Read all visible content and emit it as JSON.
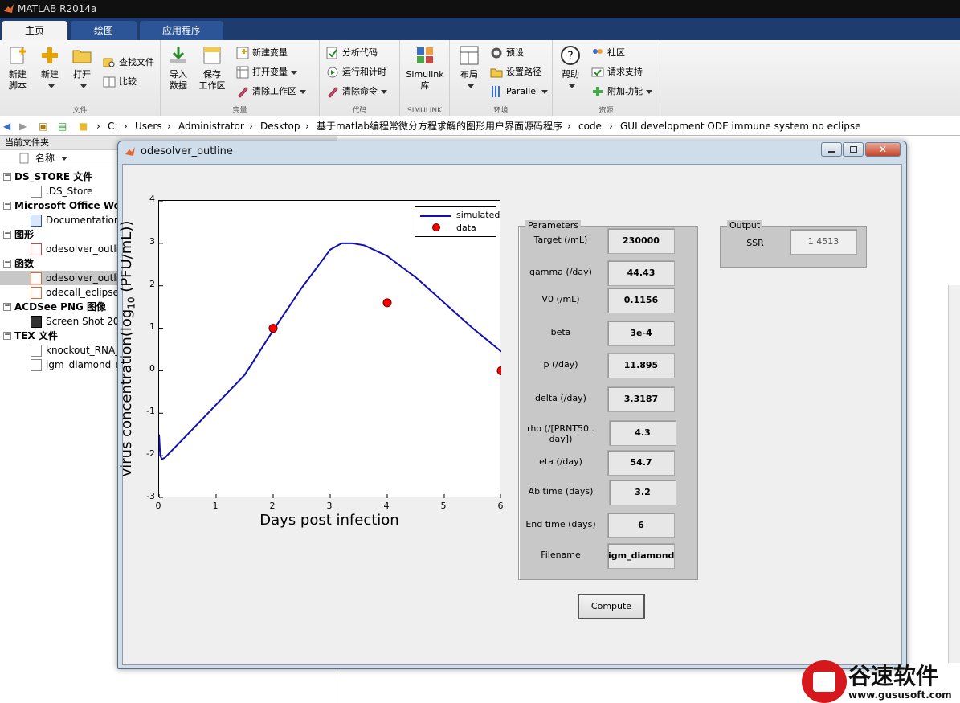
{
  "window": {
    "title": "MATLAB R2014a"
  },
  "tabs": [
    {
      "label": "主页"
    },
    {
      "label": "绘图"
    },
    {
      "label": "应用程序"
    }
  ],
  "ribbon": {
    "file": {
      "group_label": "文件",
      "new_script": "新建\n脚本",
      "new": "新建",
      "open": "打开",
      "find_files": "查找文件",
      "compare": "比较"
    },
    "variable": {
      "group_label": "变量",
      "import": "导入\n数据",
      "save_workspace": "保存\n工作区",
      "new_variable": "新建变量",
      "open_variable": "打开变量",
      "clear_workspace": "清除工作区"
    },
    "code": {
      "group_label": "代码",
      "analyze": "分析代码",
      "run_time": "运行和计时",
      "clear_commands": "清除命令"
    },
    "simulink": {
      "group_label": "SIMULINK",
      "library": "Simulink\n库"
    },
    "environment": {
      "group_label": "环境",
      "layout": "布局",
      "preferences": "预设",
      "set_path": "设置路径",
      "parallel": "Parallel"
    },
    "resources": {
      "group_label": "资源",
      "help": "帮助",
      "community": "社区",
      "request_support": "请求支持",
      "addons": "附加功能"
    }
  },
  "address": {
    "crumbs": [
      "C:",
      "Users",
      "Administrator",
      "Desktop",
      "基于matlab编程常微分方程求解的图形用户界面源码程序",
      "code",
      "GUI development ODE immune system no eclipse"
    ]
  },
  "left_pane": {
    "title": "当前文件夹",
    "column": "名称",
    "rows": [
      {
        "label": "DS_STORE 文件"
      },
      {
        "label": ".DS_Store"
      },
      {
        "label": "Microsoft Office Wo"
      },
      {
        "label": "Documentation"
      },
      {
        "label": "图形"
      },
      {
        "label": "odesolver_outli"
      },
      {
        "label": "函数"
      },
      {
        "label": "odesolver_outli"
      },
      {
        "label": "odecall_eclipse"
      },
      {
        "label": "ACDSee PNG 图像"
      },
      {
        "label": "Screen Shot 20"
      },
      {
        "label": "TEX 文件"
      },
      {
        "label": "knockout_RNA_"
      },
      {
        "label": "igm_diamond_r"
      }
    ]
  },
  "figure": {
    "title": "odesolver_outline",
    "xlabel": "Days post infection",
    "ylabel": "virus concentration(log",
    "ylabel_sub": "10",
    "ylabel_tail": " (PFU/mL))",
    "legend": {
      "line": "simulated",
      "marker": "data"
    },
    "parameters_title": "Parameters",
    "parameters": [
      {
        "label": "Target (/mL)",
        "value": "230000"
      },
      {
        "label": "gamma (/day)",
        "value": "44.43"
      },
      {
        "label": "V0 (/mL)",
        "value": "0.1156"
      },
      {
        "label": "beta",
        "value": "3e-4"
      },
      {
        "label": "p (/day)",
        "value": "11.895"
      },
      {
        "label": "delta (/day)",
        "value": "3.3187"
      },
      {
        "label": "rho (/[PRNT50 .\nday])",
        "value": "4.3"
      },
      {
        "label": "eta (/day)",
        "value": "54.7"
      },
      {
        "label": "Ab time (days)",
        "value": "3.2"
      },
      {
        "label": "End time (days)",
        "value": "6"
      },
      {
        "label": "Filename",
        "value": "igm_diamond_"
      }
    ],
    "output_title": "Output",
    "ssr_label": "SSR",
    "ssr_value": "1.4513",
    "compute_label": "Compute"
  },
  "chart_data": {
    "type": "line",
    "xlabel": "Days post infection",
    "ylabel": "virus concentration(log10 (PFU/mL))",
    "xlim": [
      0,
      6
    ],
    "ylim": [
      -3,
      4
    ],
    "xticks": [
      "0",
      "1",
      "2",
      "3",
      "4",
      "5",
      "6"
    ],
    "yticks": [
      "-3",
      "-2",
      "-1",
      "0",
      "1",
      "2",
      "3",
      "4"
    ],
    "series": [
      {
        "name": "simulated",
        "type": "line",
        "color": "#1010b0",
        "x": [
          0,
          0.02,
          0.05,
          0.1,
          0.5,
          1,
          1.5,
          2,
          2.5,
          3,
          3.2,
          3.4,
          3.6,
          4,
          4.5,
          5,
          5.5,
          6
        ],
        "y": [
          -1.5,
          -2.0,
          -2.08,
          -2.05,
          -1.5,
          -0.8,
          -0.1,
          0.95,
          1.95,
          2.85,
          3.0,
          3.0,
          2.95,
          2.7,
          2.2,
          1.6,
          1.0,
          0.45
        ]
      },
      {
        "name": "data",
        "type": "scatter",
        "color": "#ff0000",
        "x": [
          2,
          4,
          6
        ],
        "y": [
          1,
          1.6,
          0
        ]
      }
    ],
    "legend_position": "top-right"
  },
  "watermark": {
    "brand": "谷速软件",
    "url": "www.gususoft.com"
  }
}
